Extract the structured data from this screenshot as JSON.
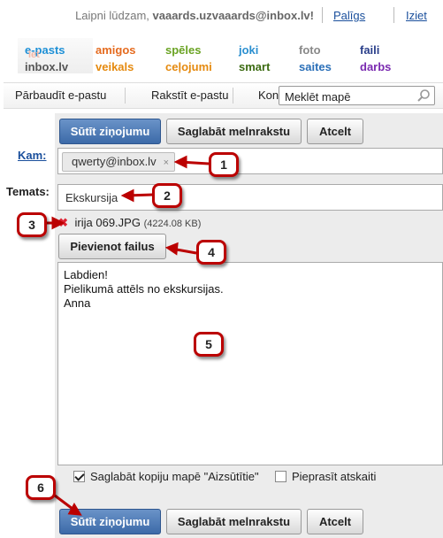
{
  "header": {
    "welcome_prefix": "Laipni lūdzam,",
    "user_email": "vaaards.uzvaaards@inbox.lv!",
    "help_link": "Palīgs",
    "logout_link": "Iziet"
  },
  "services": [
    {
      "label": "e-pasts",
      "color": "#1e90d6"
    },
    {
      "label": "amigos",
      "color": "#e56b1f"
    },
    {
      "label": "spēles",
      "color": "#6aa323"
    },
    {
      "label": "joki",
      "color": "#2b8fd0"
    },
    {
      "label": "foto",
      "color": "#888888"
    },
    {
      "label": "faili",
      "color": "#2a3f8a"
    },
    {
      "label": "inbox.lv",
      "color": "#555555"
    },
    {
      "label": "veikals",
      "color": "#e58a0f"
    },
    {
      "label": "ceļojumi",
      "color": "#e58a0f"
    },
    {
      "label": "smart",
      "color": "#3c6b12"
    },
    {
      "label": "saites",
      "color": "#2a6fb8"
    },
    {
      "label": "darbs",
      "color": "#7a2ab0"
    }
  ],
  "services_overlay": "let",
  "toolbar": {
    "check_mail": "Pārbaudīt e-pastu",
    "compose": "Rakstīt e-pastu",
    "contacts_partial": "Kon",
    "search_placeholder": "Meklēt mapē"
  },
  "compose": {
    "send_label": "Sūtīt ziņojumu",
    "save_draft_label": "Saglabāt melnrakstu",
    "cancel_label": "Atcelt",
    "to_label": "Kam:",
    "recipient": "qwerty@inbox.lv",
    "recipient_remove": "×",
    "subject_label": "Temats:",
    "subject_value": "Ekskursija",
    "attachment_remove": "✖",
    "attachment_name": "irija 069.JPG",
    "attachment_size": "(4224.08 KB)",
    "add_files_label": "Pievienot failus",
    "body_text": "Labdien!\nPielikumā attēls no ekskursijas.\nAnna",
    "save_copy_label": "Saglabāt kopiju mapē \"Aizsūtītie\"",
    "save_copy_checked": true,
    "read_receipt_label": "Pieprasīt atskaiti",
    "read_receipt_checked": false
  },
  "callouts": [
    "1",
    "2",
    "3",
    "4",
    "5",
    "6"
  ],
  "colors": {
    "link": "#1a4f9c",
    "primary_button": "#3c6aa8",
    "callout_border": "#b00000",
    "compose_bg": "#ececec"
  }
}
